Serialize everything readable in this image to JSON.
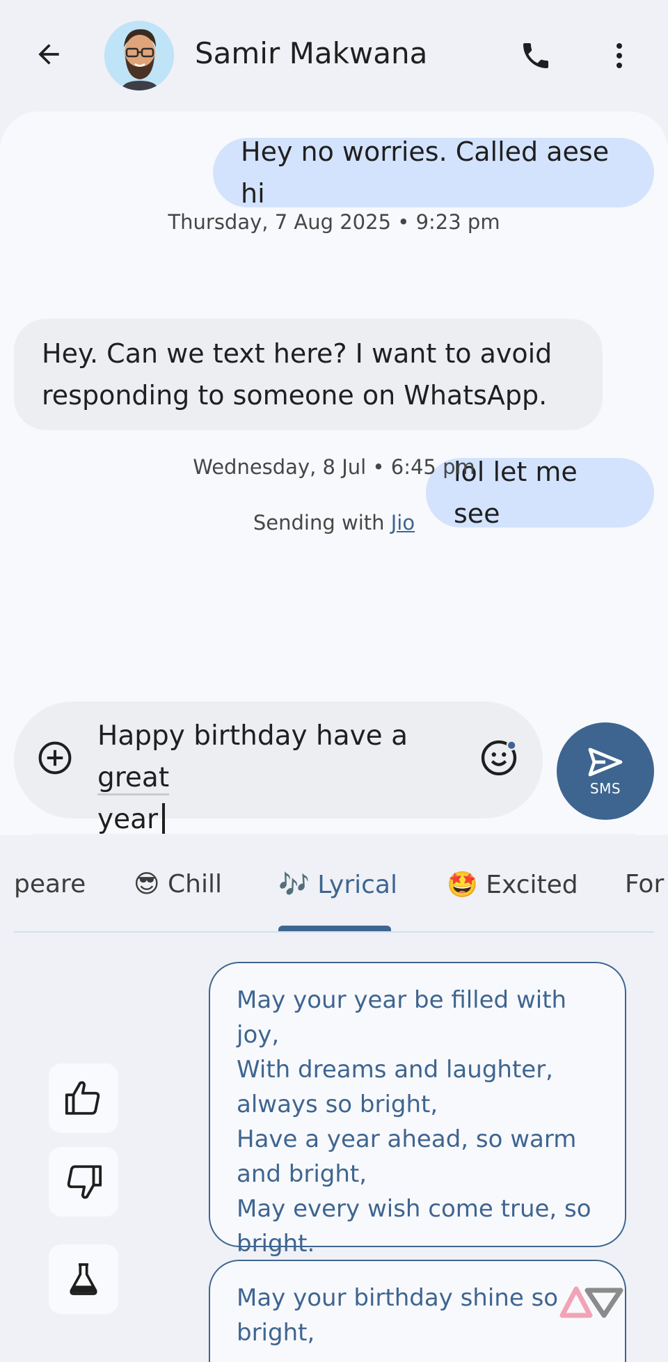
{
  "header": {
    "contact_name": "Samir Makwana"
  },
  "messages": [
    {
      "direction": "out",
      "text": "Hey no worries. Called aese hi"
    },
    {
      "type": "timestamp",
      "text": "Thursday, 7 Aug 2025 • 9:23 pm"
    },
    {
      "direction": "in",
      "lines": [
        "Hey. Can we text here? I want to avoid",
        "responding to someone on WhatsApp."
      ]
    },
    {
      "direction": "out",
      "text": "lol let me see"
    },
    {
      "type": "timestamp",
      "text": "Wednesday, 8 Jul • 6:45 pm"
    }
  ],
  "sending_with": {
    "prefix": "Sending with ",
    "carrier": "Jio"
  },
  "compose": {
    "line1_pre": "Happy birthday have a ",
    "line1_word": "great",
    "line2_word": "year"
  },
  "send_button": {
    "label": "SMS"
  },
  "tabs": [
    {
      "emoji": "",
      "label": "peare"
    },
    {
      "emoji": "😎",
      "label": "Chill"
    },
    {
      "emoji": "🎶",
      "label": "Lyrical",
      "active": true
    },
    {
      "emoji": "🤩",
      "label": "Excited"
    },
    {
      "emoji": "",
      "label": "For"
    }
  ],
  "suggestions": [
    {
      "lines": [
        "May your year be filled with joy,",
        "With dreams and laughter,",
        "always so bright,",
        "Have a year ahead, so warm",
        "and bright,",
        "May every wish come true, so",
        "bright."
      ]
    },
    {
      "lines": [
        "May your birthday shine so",
        "bright,"
      ]
    }
  ],
  "colors": {
    "accent": "#3e6590",
    "outgoing_bubble": "#d3e3fd",
    "incoming_bubble": "#eceef2",
    "background": "#eff1f6"
  }
}
